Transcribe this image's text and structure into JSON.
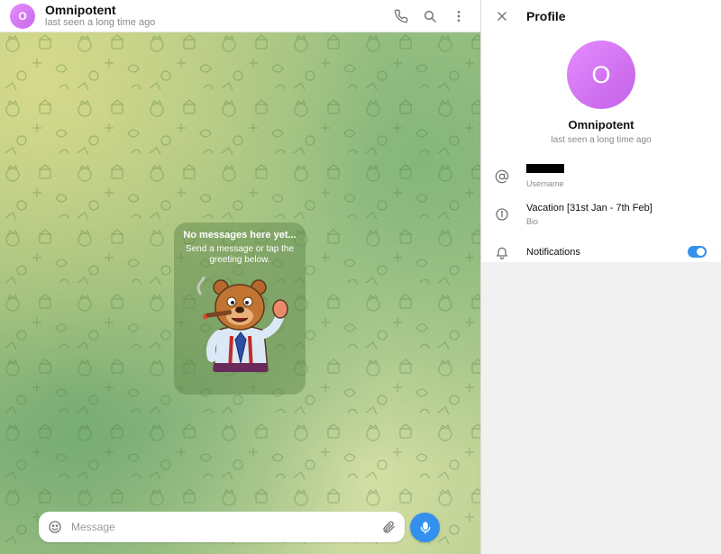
{
  "chat": {
    "avatar_letter": "O",
    "title": "Omnipotent",
    "status": "last seen a long time ago",
    "empty_title": "No messages here yet...",
    "empty_subtitle": "Send a message or tap the greeting below.",
    "message_placeholder": "Message"
  },
  "profile": {
    "title": "Profile",
    "avatar_letter": "O",
    "name": "Omnipotent",
    "status": "last seen a long time ago",
    "username_label": "Username",
    "bio_value": "Vacation [31st Jan - 7th Feb]",
    "bio_label": "Bio",
    "notifications_label": "Notifications",
    "notifications_on": true
  },
  "colors": {
    "accent": "#3390ec",
    "avatar": "#d47cf0"
  },
  "icons": {
    "call": "phone-icon",
    "search": "search-icon",
    "more": "more-vertical-icon",
    "close": "close-icon",
    "username": "at-icon",
    "bio": "info-icon",
    "notifications": "bell-icon",
    "emoji": "smile-icon",
    "attach": "paperclip-icon",
    "voice": "microphone-icon"
  }
}
